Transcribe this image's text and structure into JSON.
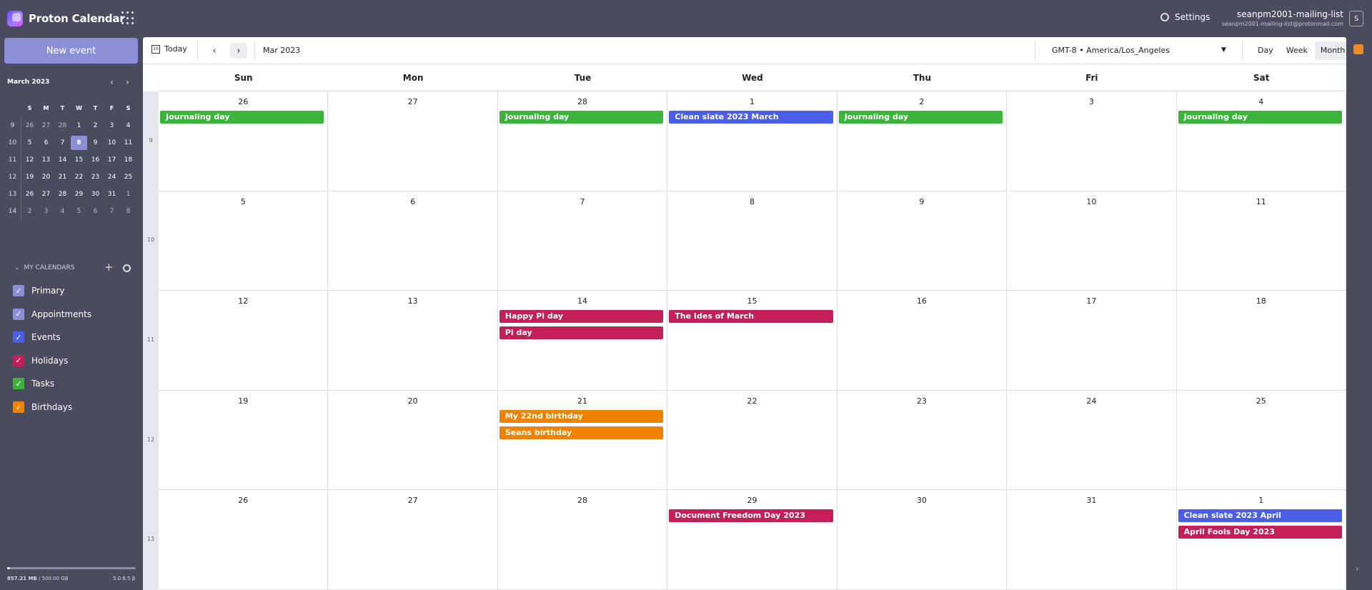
{
  "app": {
    "title": "Proton Calendar",
    "settings_label": "Settings",
    "user_name": "seanpm2001-mailing-list",
    "user_email": "seanpm2001-mailing-list@protonmail.com",
    "avatar": "S"
  },
  "sidebar": {
    "new_event_label": "New event",
    "mini_title": "March 2023",
    "mini_days": [
      "S",
      "M",
      "T",
      "W",
      "T",
      "F",
      "S"
    ],
    "mini_weeks": [
      {
        "week": "9",
        "days": [
          "26",
          "27",
          "28",
          "1",
          "2",
          "3",
          "4"
        ]
      },
      {
        "week": "10",
        "days": [
          "5",
          "6",
          "7",
          "8",
          "9",
          "10",
          "11"
        ]
      },
      {
        "week": "11",
        "days": [
          "12",
          "13",
          "14",
          "15",
          "16",
          "17",
          "18"
        ]
      },
      {
        "week": "12",
        "days": [
          "19",
          "20",
          "21",
          "22",
          "23",
          "24",
          "25"
        ]
      },
      {
        "week": "13",
        "days": [
          "26",
          "27",
          "28",
          "29",
          "30",
          "31",
          "1"
        ]
      },
      {
        "week": "14",
        "days": [
          "2",
          "3",
          "4",
          "5",
          "6",
          "7",
          "8"
        ]
      }
    ],
    "my_calendars_label": "MY CALENDARS",
    "calendars": [
      {
        "name": "Primary",
        "color": "#8b8fd6"
      },
      {
        "name": "Appointments",
        "color": "#8b8fd6"
      },
      {
        "name": "Events",
        "color": "#4b5ee8"
      },
      {
        "name": "Holidays",
        "color": "#c41f58"
      },
      {
        "name": "Tasks",
        "color": "#3bb43b"
      },
      {
        "name": "Birthdays",
        "color": "#f08200"
      }
    ],
    "storage_used": "857.21 MB",
    "storage_total": "/ 500.00 GB",
    "storage_fraction": 0.02,
    "version": "5.0.6.5 β"
  },
  "toolbar": {
    "today_label": "Today",
    "today_icon": "10",
    "current_range": "Mar 2023",
    "timezone": "GMT-8 • America/Los_Angeles",
    "views": [
      "Day",
      "Week",
      "Month"
    ],
    "active_view": "Month"
  },
  "calendar": {
    "day_names": [
      "Sun",
      "Mon",
      "Tue",
      "Wed",
      "Thu",
      "Fri",
      "Sat"
    ],
    "weeks": [
      {
        "week": "9",
        "days": [
          {
            "num": "26",
            "events": [
              {
                "title": "Journaling day",
                "color": "#3bb43b"
              }
            ]
          },
          {
            "num": "27",
            "events": []
          },
          {
            "num": "28",
            "events": [
              {
                "title": "Journaling day",
                "color": "#3bb43b"
              }
            ]
          },
          {
            "num": "1",
            "events": [
              {
                "title": "Clean slate 2023 March",
                "color": "#4b5ee8"
              }
            ]
          },
          {
            "num": "2",
            "events": [
              {
                "title": "Journaling day",
                "color": "#3bb43b"
              }
            ]
          },
          {
            "num": "3",
            "events": []
          },
          {
            "num": "4",
            "events": [
              {
                "title": "Journaling day",
                "color": "#3bb43b"
              }
            ]
          }
        ]
      },
      {
        "week": "10",
        "days": [
          {
            "num": "5",
            "events": []
          },
          {
            "num": "6",
            "events": []
          },
          {
            "num": "7",
            "events": []
          },
          {
            "num": "8",
            "events": []
          },
          {
            "num": "9",
            "events": []
          },
          {
            "num": "10",
            "events": []
          },
          {
            "num": "11",
            "events": []
          }
        ]
      },
      {
        "week": "11",
        "days": [
          {
            "num": "12",
            "events": []
          },
          {
            "num": "13",
            "events": []
          },
          {
            "num": "14",
            "events": [
              {
                "title": "Happy Pi day",
                "color": "#c41f58"
              },
              {
                "title": "Pi day",
                "color": "#c41f58"
              }
            ]
          },
          {
            "num": "15",
            "events": [
              {
                "title": "The Ides of March",
                "color": "#c41f58"
              }
            ]
          },
          {
            "num": "16",
            "events": []
          },
          {
            "num": "17",
            "events": []
          },
          {
            "num": "18",
            "events": []
          }
        ]
      },
      {
        "week": "12",
        "days": [
          {
            "num": "19",
            "events": []
          },
          {
            "num": "20",
            "events": []
          },
          {
            "num": "21",
            "events": [
              {
                "title": "My 22nd birthday",
                "color": "#f08200"
              },
              {
                "title": "Seans birthday",
                "color": "#f08200"
              }
            ]
          },
          {
            "num": "22",
            "events": []
          },
          {
            "num": "23",
            "events": []
          },
          {
            "num": "24",
            "events": []
          },
          {
            "num": "25",
            "events": []
          }
        ]
      },
      {
        "week": "13",
        "days": [
          {
            "num": "26",
            "events": []
          },
          {
            "num": "27",
            "events": []
          },
          {
            "num": "28",
            "events": []
          },
          {
            "num": "29",
            "events": [
              {
                "title": "Document Freedom Day 2023",
                "color": "#c41f58"
              }
            ]
          },
          {
            "num": "30",
            "events": []
          },
          {
            "num": "31",
            "events": []
          },
          {
            "num": "1",
            "events": [
              {
                "title": "Clean slate 2023 April",
                "color": "#4b5ee8"
              },
              {
                "title": "April Fools Day 2023",
                "color": "#c41f58"
              }
            ]
          }
        ]
      }
    ]
  }
}
